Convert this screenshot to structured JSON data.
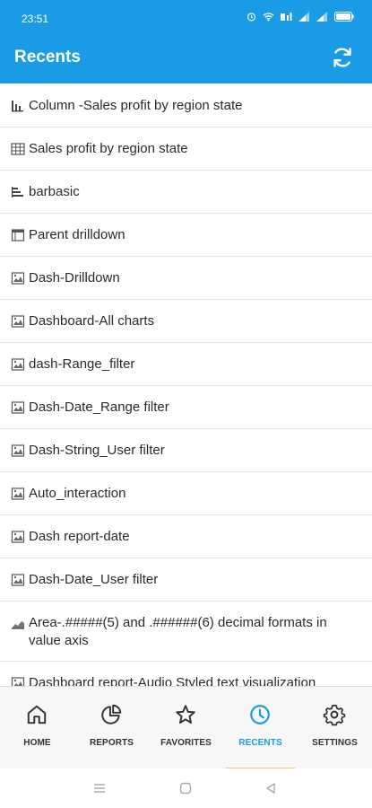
{
  "status_bar": {
    "time": "23:51"
  },
  "app_bar": {
    "title": "Recents"
  },
  "recents": [
    {
      "label": "Column -Sales profit by region state",
      "icon": "column-chart-icon"
    },
    {
      "label": "Sales profit by region state",
      "icon": "table-icon"
    },
    {
      "label": "barbasic",
      "icon": "bar-chart-icon"
    },
    {
      "label": "Parent drilldown",
      "icon": "crosstab-icon"
    },
    {
      "label": "Dash-Drilldown",
      "icon": "dashboard-icon"
    },
    {
      "label": "Dashboard-All charts",
      "icon": "dashboard-icon"
    },
    {
      "label": "dash-Range_filter",
      "icon": "dashboard-icon"
    },
    {
      "label": "Dash-Date_Range filter",
      "icon": "dashboard-icon"
    },
    {
      "label": "Dash-String_User filter",
      "icon": "dashboard-icon"
    },
    {
      "label": "Auto_interaction",
      "icon": "dashboard-icon"
    },
    {
      "label": "Dash report-date",
      "icon": "dashboard-icon"
    },
    {
      "label": "Dash-Date_User filter",
      "icon": "dashboard-icon"
    },
    {
      "label": "Area-.#####(5) and .######(6) decimal formats in value axis",
      "icon": "area-chart-icon"
    },
    {
      "label": "Dashboard report-Audio Styled text visualization",
      "icon": "dashboard-icon"
    }
  ],
  "bottom_nav": {
    "items": [
      {
        "label": "HOME",
        "icon": "home-icon"
      },
      {
        "label": "REPORTS",
        "icon": "pie-chart-icon"
      },
      {
        "label": "FAVORITES",
        "icon": "star-icon"
      },
      {
        "label": "RECENTS",
        "icon": "clock-icon",
        "active": true
      },
      {
        "label": "SETTINGS",
        "icon": "gear-icon"
      }
    ]
  },
  "colors": {
    "primary": "#1a9be6",
    "indicator": "#f7c470"
  }
}
